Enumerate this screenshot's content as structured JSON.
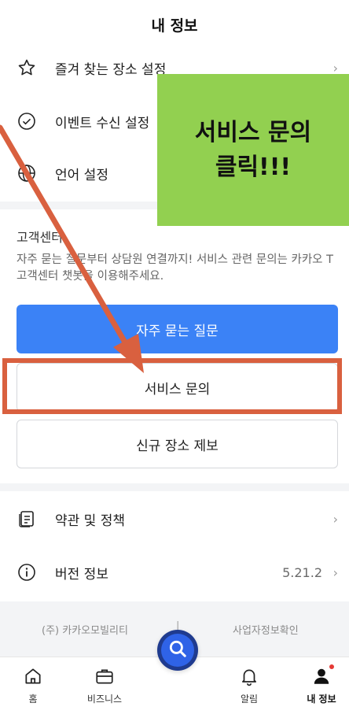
{
  "header": {
    "title": "내 정보"
  },
  "menu_top": [
    {
      "icon": "star-icon",
      "label": "즐겨 찾는 장소 설정"
    },
    {
      "icon": "check-circle-icon",
      "label": "이벤트 수신 설정"
    },
    {
      "icon": "globe-icon",
      "label": "언어 설정"
    }
  ],
  "customer_center": {
    "title": "고객센터",
    "description": "자주 묻는 질문부터 상담원 연결까지! 서비스 관련 문의는 카카오 T 고객센터 챗봇을 이용해주세요.",
    "faq_button": "자주 묻는 질문",
    "service_button": "서비스 문의",
    "place_button": "신규 장소 제보"
  },
  "menu_bottom": [
    {
      "icon": "document-icon",
      "label": "약관 및 정책"
    },
    {
      "icon": "info-icon",
      "label": "버전 정보",
      "value": "5.21.2"
    }
  ],
  "footer": {
    "left": "(주) 카카오모빌리티",
    "separator": "|",
    "right": "사업자정보확인"
  },
  "tabs": [
    {
      "icon": "home-icon",
      "label": "홈"
    },
    {
      "icon": "briefcase-icon",
      "label": "비즈니스"
    },
    {
      "icon": "bell-icon",
      "label": "알림"
    },
    {
      "icon": "person-icon",
      "label": "내 정보",
      "active": true
    }
  ],
  "annotation": {
    "text": "서비스 문의\n클릭!!!"
  },
  "colors": {
    "primary": "#3b82f6",
    "highlight": "#d9603f",
    "callout": "#92d050",
    "divider": "#f3f4f6",
    "badge": "#e53935"
  }
}
